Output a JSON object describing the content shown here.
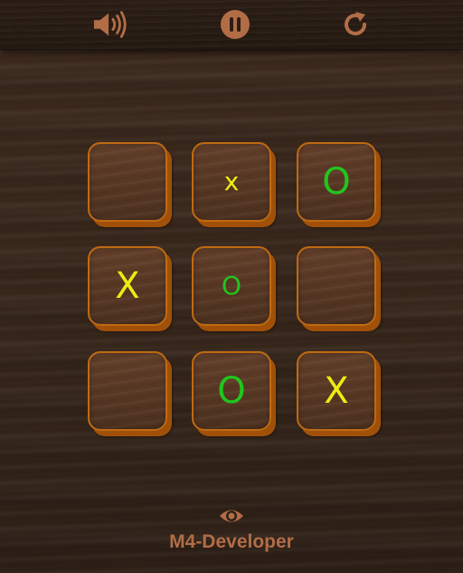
{
  "toolbar": {
    "sound_icon": "speaker-volume-icon",
    "pause_icon": "pause-icon",
    "restart_icon": "restart-icon"
  },
  "board": {
    "cells": [
      {
        "mark": "",
        "size": "large"
      },
      {
        "mark": "x",
        "size": "small"
      },
      {
        "mark": "O",
        "size": "large"
      },
      {
        "mark": "X",
        "size": "large"
      },
      {
        "mark": "O",
        "size": "small"
      },
      {
        "mark": "",
        "size": "large"
      },
      {
        "mark": "",
        "size": "large"
      },
      {
        "mark": "O",
        "size": "large"
      },
      {
        "mark": "X",
        "size": "large"
      }
    ]
  },
  "footer": {
    "eye_icon": "eye-icon",
    "credit": "M4-Developer"
  },
  "colors": {
    "x_mark": "#eded0f",
    "o_mark": "#22c51d",
    "cell_border": "#c06a12",
    "icon": "#b26d47"
  }
}
